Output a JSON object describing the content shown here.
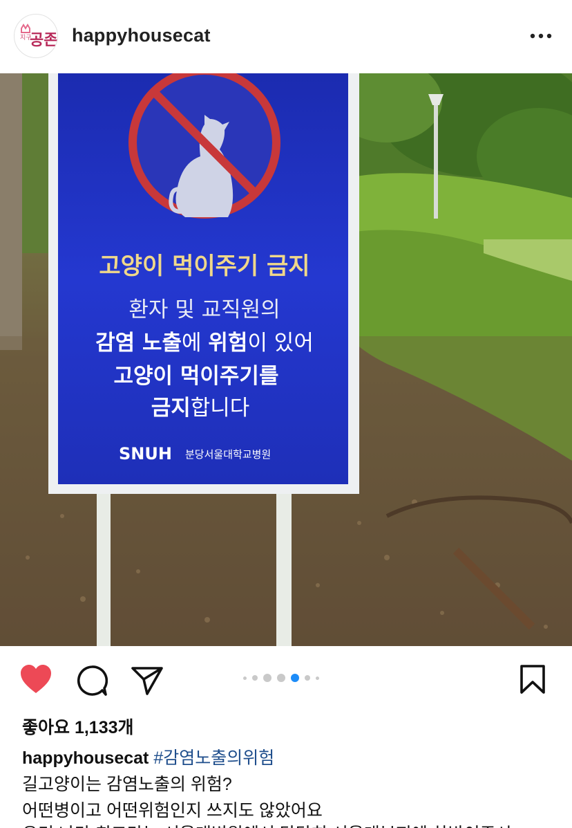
{
  "header": {
    "avatar_text": "길고양이 공존",
    "username": "happyhousecat"
  },
  "post": {
    "sign": {
      "title": "고양이 먹이주기 금지",
      "line1": "환자 및 교직원의",
      "line2_bold_a": "감염 노출",
      "line2_mid": "에 ",
      "line2_bold_b": "위험",
      "line2_end": "이 있어",
      "line3": "고양이 먹이주기를",
      "line4_bold": "금지",
      "line4_end": "합니다",
      "brand": "SNUH",
      "brand_sub": "분당서울대학교병원"
    },
    "carousel": {
      "count": 6,
      "active": 3
    },
    "colors": {
      "like": "#ed4956",
      "hashtag": "#1f4e8c",
      "sign_blue": "#1a2fc0",
      "sign_text_yellow": "#f0d88a"
    }
  },
  "likes_text": "좋아요 1,133개",
  "caption": {
    "username": "happyhousecat",
    "hashtag": "#감염노출의위험",
    "line2": "길고양이는 감염노출의 위험?",
    "line3": "어떤병이고 어떤위험인지 쓰지도 않았어요",
    "line4": "우리 나라 최고라는 서울대병원에서 당당히 서울대부지에 차박이주시"
  },
  "icons": [
    "more-icon",
    "heart-icon",
    "comment-icon",
    "share-icon",
    "bookmark-icon"
  ]
}
